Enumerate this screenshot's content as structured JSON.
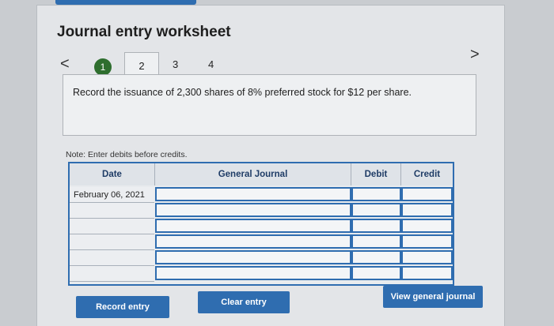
{
  "worksheet": {
    "title": "Journal entry worksheet",
    "nav_prev": "<",
    "nav_next": ">",
    "steps": [
      "1",
      "2",
      "3",
      "4"
    ],
    "prompt": "Record the issuance of 2,300 shares of 8% preferred stock for $12 per share.",
    "note": "Note: Enter debits before credits."
  },
  "journal_table": {
    "headers": {
      "date": "Date",
      "general_journal": "General Journal",
      "debit": "Debit",
      "credit": "Credit"
    },
    "rows": [
      {
        "date": "February 06, 2021",
        "account": "",
        "debit": "",
        "credit": ""
      },
      {
        "date": "",
        "account": "",
        "debit": "",
        "credit": ""
      },
      {
        "date": "",
        "account": "",
        "debit": "",
        "credit": ""
      },
      {
        "date": "",
        "account": "",
        "debit": "",
        "credit": ""
      },
      {
        "date": "",
        "account": "",
        "debit": "",
        "credit": ""
      },
      {
        "date": "",
        "account": "",
        "debit": "",
        "credit": ""
      }
    ]
  },
  "buttons": {
    "record_entry": "Record entry",
    "clear_entry": "Clear entry",
    "view_general_journal": "View general journal"
  },
  "colors": {
    "accent": "#2f6db0",
    "step_complete": "#2e6e2e"
  }
}
